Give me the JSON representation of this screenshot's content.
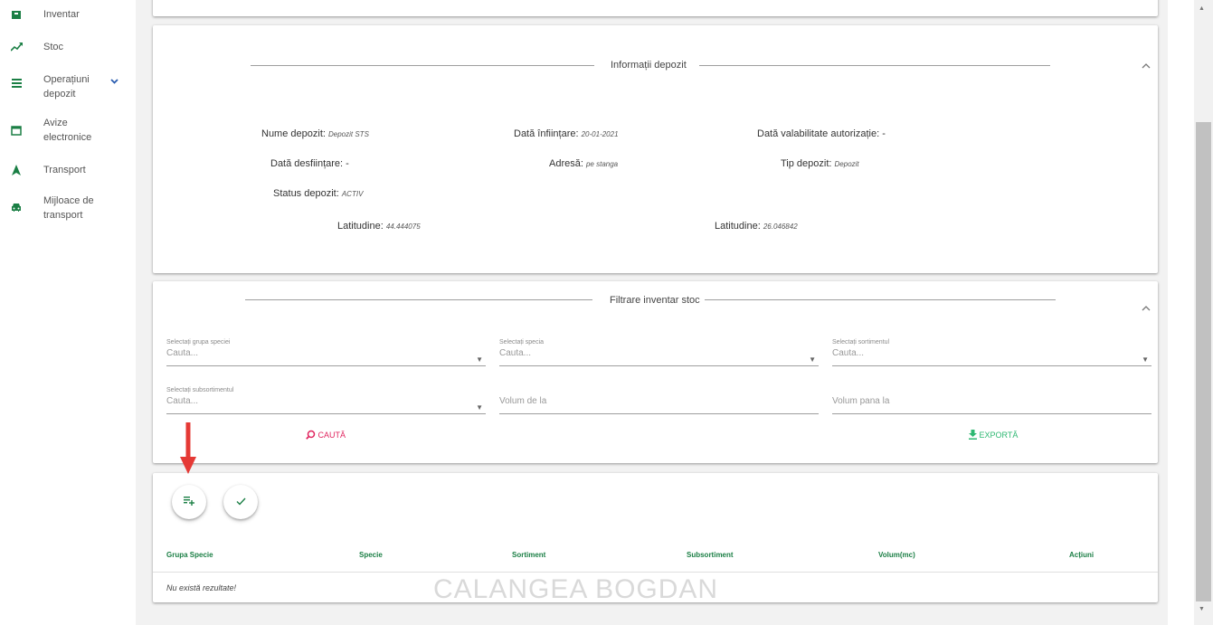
{
  "sidebar": {
    "items": [
      {
        "label": "Inventar",
        "icon": "inventory-icon"
      },
      {
        "label": "Stoc",
        "icon": "trending-up-icon"
      },
      {
        "label": "Operațiuni depozit",
        "icon": "list-icon"
      },
      {
        "label": "Avize electronice",
        "icon": "document-icon"
      },
      {
        "label": "Transport",
        "icon": "navigation-icon"
      },
      {
        "label": "Mijloace de transport",
        "icon": "car-icon"
      }
    ]
  },
  "info": {
    "title": "Informații depozit",
    "nume_label": "Nume depozit:",
    "nume_value": "Depozit STS",
    "infiintare_label": "Dată înființare:",
    "infiintare_value": "20-01-2021",
    "valabilitate_label": "Dată valabilitate autorizație:",
    "valabilitate_value": "-",
    "desfiintare_label": "Dată desființare:",
    "desfiintare_value": "-",
    "adresa_label": "Adresă:",
    "adresa_value": "pe stanga",
    "tip_label": "Tip depozit:",
    "tip_value": "Depozit",
    "status_label": "Status depozit:",
    "status_value": "ACTIV",
    "lat_label": "Latitudine:",
    "lat_value": "44.444075",
    "lon_label": "Latitudine:",
    "lon_value": "26.046842"
  },
  "filter": {
    "title": "Filtrare inventar stoc",
    "grupa_label": "Selectați grupa speciei",
    "grupa_placeholder": "Cauta...",
    "specia_label": "Selectați specia",
    "specia_placeholder": "Cauta...",
    "sortiment_label": "Selectați sortimentul",
    "sortiment_placeholder": "Cauta...",
    "subsortiment_label": "Selectați subsortimentul",
    "subsortiment_placeholder": "Cauta...",
    "volum_de_la": "Volum de la",
    "volum_pana_la": "Volum pana la",
    "cauta_button": "CAUTĂ",
    "exporta_button": "EXPORTĂ"
  },
  "table": {
    "headers": [
      "Grupa Specie",
      "Specie",
      "Sortiment",
      "Subsortiment",
      "Volum(mc)",
      "Acțiuni"
    ],
    "empty_text": "Nu există rezultate!",
    "watermark": "CALANGEA BOGDAN"
  },
  "colors": {
    "accent_green": "#1b7f45",
    "search_red": "#e0245e",
    "export_green": "#2eb872",
    "arrow_red": "#e53935"
  }
}
